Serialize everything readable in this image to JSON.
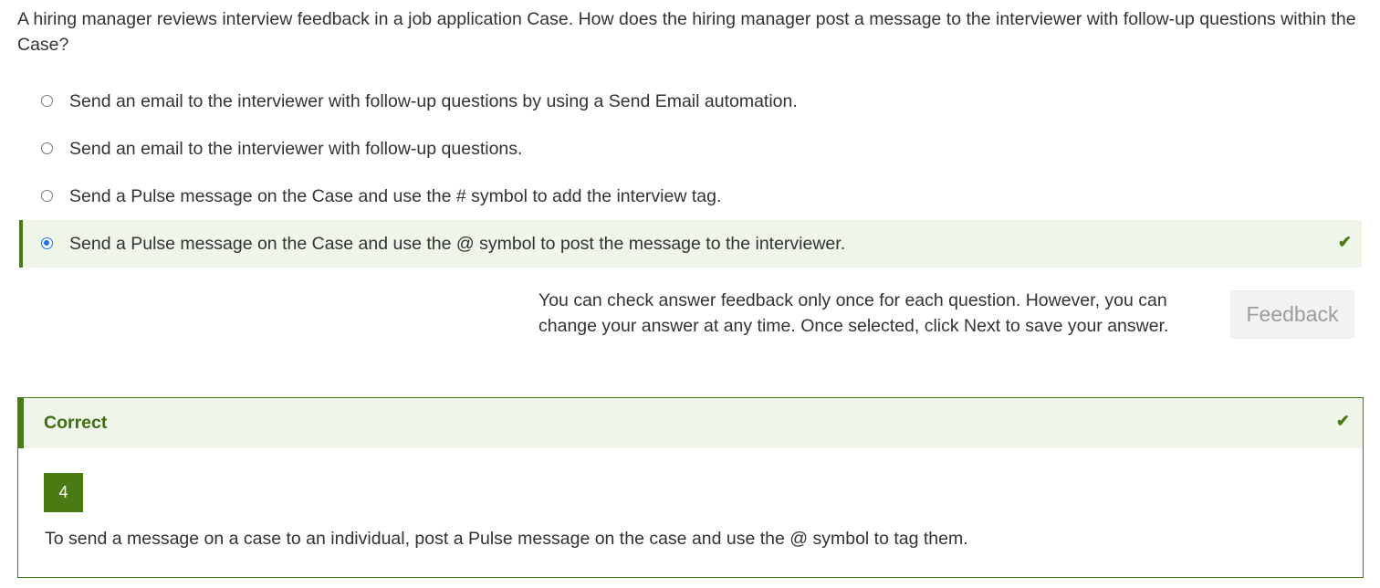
{
  "question": {
    "text": "A hiring manager reviews interview feedback in a job application Case. How does the hiring manager post a message to the interviewer with follow-up questions within the Case?"
  },
  "options": [
    {
      "label": "Send an email to the interviewer with follow-up questions by using a Send Email automation.",
      "selected": false
    },
    {
      "label": "Send an email to the interviewer with follow-up questions.",
      "selected": false
    },
    {
      "label": "Send a Pulse message on the Case and use the # symbol to add the interview tag.",
      "selected": false
    },
    {
      "label": "Send a Pulse message on the Case and use the @ symbol to post the message to the interviewer.",
      "selected": true
    }
  ],
  "icons": {
    "option_correct": "check-icon",
    "result_correct": "check-icon"
  },
  "feedback": {
    "note": "You can check answer feedback only once for each question. However, you can change your answer at any time. Once selected, click Next to save your answer.",
    "button_label": "Feedback"
  },
  "result": {
    "status": "Correct",
    "answer_number": "4",
    "explanation": "To send a message on a case to an individual, post a Pulse message on the case and use the @ symbol to tag them."
  },
  "colors": {
    "accent_green": "#4b7a12",
    "highlight_bg": "#eef6ea",
    "radio_blue": "#1a73e8"
  }
}
